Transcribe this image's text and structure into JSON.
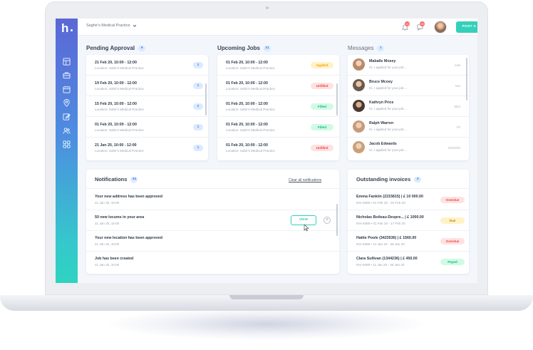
{
  "topbar": {
    "practice_name": "Saghir's Medical Practice",
    "notification_count_1": "15",
    "notification_count_2": "25",
    "post_job_label": "POST A JOB"
  },
  "sidebar": {
    "logo_text": "h",
    "icons": [
      "layout-icon",
      "briefcase-icon",
      "calendar-icon",
      "location-icon",
      "edit-icon",
      "users-icon",
      "grid-icon"
    ]
  },
  "pending": {
    "title": "Pending Approval",
    "count": "6",
    "items": [
      {
        "date": "21 Feb 20, 10:00 - 12:00",
        "location": "Location: Sahir's Medical Practice",
        "count": "1"
      },
      {
        "date": "19 Feb 20, 10:00 - 12:00",
        "location": "Location: Sahir's Medical Practice",
        "count": "1"
      },
      {
        "date": "15 Feb 20, 10:00 - 12:00",
        "location": "Location: Sahir's Medical Practice",
        "count": "2"
      },
      {
        "date": "01 Feb 20, 10:00 - 12:00",
        "location": "Location: Sahir's Medical Practice",
        "count": "1"
      },
      {
        "date": "21 Jan 20, 10:00 - 12:00",
        "location": "Location: Sahir's Medical Practice",
        "count": "1"
      }
    ]
  },
  "upcoming": {
    "title": "Upcoming Jobs",
    "count": "21",
    "items": [
      {
        "date": "01 Feb 20, 10:00 - 12:00",
        "location": "Location: Sahir's Medical Practice",
        "status": "Applied",
        "color": "#f59e0b",
        "bg": "#fef3c7"
      },
      {
        "date": "01 Feb 20, 10:00 - 12:00",
        "location": "Location: Sahir's Medical Practice",
        "status": "Unfilled",
        "color": "#ef4444",
        "bg": "#fee2e2"
      },
      {
        "date": "01 Feb 20, 10:00 - 12:00",
        "location": "Location: Sahir's Medical Practice",
        "status": "Filled",
        "color": "#10b981",
        "bg": "#d1fae5"
      },
      {
        "date": "01 Feb 20, 10:00 - 12:00",
        "location": "Location: Sahir's Medical Practice",
        "status": "Filled",
        "color": "#10b981",
        "bg": "#d1fae5"
      },
      {
        "date": "01 Feb 20, 10:00 - 12:00",
        "location": "Location: Sahir's Medical Practice",
        "status": "Unfilled",
        "color": "#ef4444",
        "bg": "#fee2e2"
      }
    ]
  },
  "messages": {
    "title": "Messages",
    "count": "1",
    "items": [
      {
        "name": "Maballe Mosey",
        "text": "Hi, I applied for your job ...",
        "time": "now"
      },
      {
        "name": "Bruce Mcoey",
        "text": "Hi, I applied for your job ...",
        "time": "Tue"
      },
      {
        "name": "Kathryn Price",
        "text": "Hi, I applied for your job ...",
        "time": "Mon"
      },
      {
        "name": "Ralph Warren",
        "text": "Hi, I applied for your job ...",
        "time": "Fri"
      },
      {
        "name": "Jacob Edwards",
        "text": "Hi, I applied for your job ...",
        "time": "01/02/20"
      }
    ]
  },
  "notifications": {
    "title": "Notifications",
    "count": "34",
    "clear_label": "Clear all notifications",
    "view_label": "VIEW",
    "items": [
      {
        "title": "Your new address has been approved",
        "date": "21 Jan 20, 10:00"
      },
      {
        "title": "50 new locums in your area",
        "date": "21 Jan 20, 10:00"
      },
      {
        "title": "Your new location has been approved",
        "date": "21 Jan 20, 10:00"
      },
      {
        "title": "Job has been created",
        "date": "21 Jan 20, 10:00"
      }
    ]
  },
  "invoices": {
    "title": "Outstanding invoices",
    "count": "4",
    "items": [
      {
        "title": "Emma Fankiin (2215815)   |   £ 10 000.00",
        "sub": "INV-4088  •  01 Feb 20 - 22 Feb 20",
        "status": "Overdue",
        "color": "#ef4444",
        "bg": "#fee2e2"
      },
      {
        "title": "Nicholas Boileau-Despre...   |   £ 1000.00",
        "sub": "INV-4088  •  01 Feb 20 - 17 Feb 20",
        "status": "Due",
        "color": "#d97706",
        "bg": "#fef3c7"
      },
      {
        "title": "Hattie Poole (3423536)   |   £ 1560.00",
        "sub": "INV-4088  •  21 Jan 20 - 28 Jan 20",
        "status": "Overdue",
        "color": "#ef4444",
        "bg": "#fee2e2"
      },
      {
        "title": "Clara Sullivan (1344236)   |   £ 450.00",
        "sub": "INV-4088  •  11 Jan 20 - 30 Jan 20",
        "status": "Payed",
        "color": "#10b981",
        "bg": "#d1fae5"
      }
    ]
  }
}
